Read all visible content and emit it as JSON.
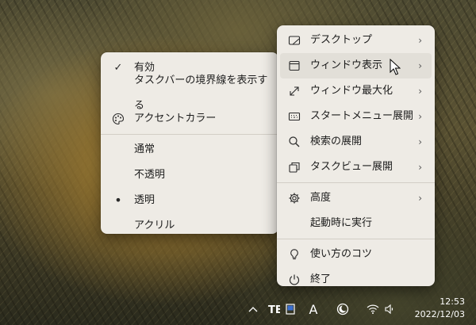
{
  "submenu": {
    "items": [
      {
        "label": "有効",
        "lead": "✓"
      },
      {
        "label": "タスクバーの境界線を表示する",
        "lead": ""
      },
      {
        "label": "アクセントカラー",
        "lead": "palette-icon"
      },
      {
        "label": "通常",
        "lead": ""
      },
      {
        "label": "不透明",
        "lead": ""
      },
      {
        "label": "透明",
        "lead": "•"
      },
      {
        "label": "アクリル",
        "lead": ""
      }
    ]
  },
  "mainmenu": {
    "items": [
      {
        "label": "デスクトップ",
        "icon": "desktop-icon",
        "chevron": "›"
      },
      {
        "label": "ウィンドウ表示",
        "icon": "window-icon",
        "chevron": "›"
      },
      {
        "label": "ウィンドウ最大化",
        "icon": "maximize-icon",
        "chevron": "›"
      },
      {
        "label": "スタートメニュー展開",
        "icon": "keyboard-icon",
        "chevron": "›"
      },
      {
        "label": "検索の展開",
        "icon": "search-icon",
        "chevron": "›"
      },
      {
        "label": "タスクビュー展開",
        "icon": "task-view-icon",
        "chevron": "›"
      },
      {
        "label": "高度",
        "icon": "gear-icon",
        "chevron": "›"
      },
      {
        "label": "起動時に実行",
        "icon": "",
        "chevron": ""
      },
      {
        "label": "使い方のコツ",
        "icon": "lightbulb-icon",
        "chevron": ""
      },
      {
        "label": "終了",
        "icon": "power-icon",
        "chevron": ""
      }
    ]
  },
  "taskbar": {
    "ime_label": "A",
    "time": "12:53",
    "date": "2022/12/03"
  }
}
